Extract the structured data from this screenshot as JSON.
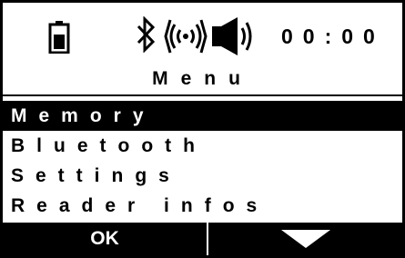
{
  "status": {
    "icons": [
      "battery-icon",
      "bluetooth-icon",
      "signal-icon",
      "speaker-icon"
    ],
    "time": "00:00"
  },
  "title": "Menu",
  "menu": {
    "items": [
      {
        "label": "Memory",
        "selected": true
      },
      {
        "label": "Bluetooth",
        "selected": false
      },
      {
        "label": "Settings",
        "selected": false
      },
      {
        "label": "Reader infos",
        "selected": false
      }
    ]
  },
  "softkeys": {
    "left_label": "OK",
    "right_icon": "down-arrow-icon"
  },
  "colors": {
    "foreground": "#000000",
    "background": "#ffffff"
  }
}
